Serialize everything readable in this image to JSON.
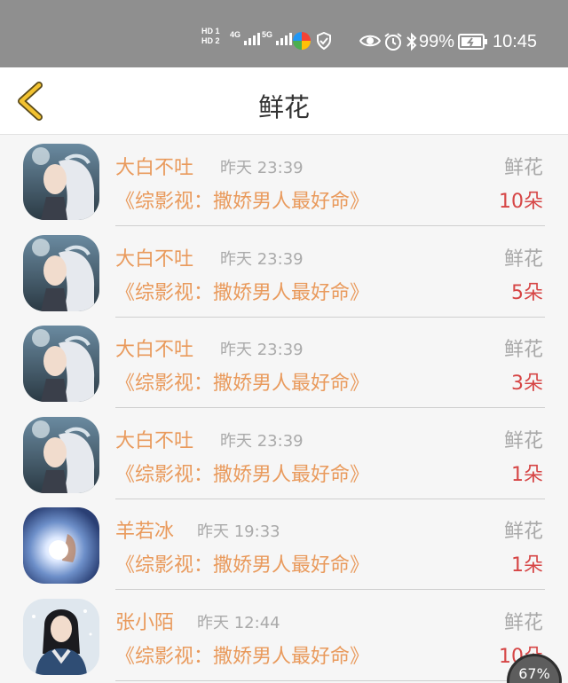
{
  "status_bar": {
    "hd1": "HD 1",
    "hd2": "HD 2",
    "net1": "4G",
    "net2": "5G",
    "battery": "99%",
    "time": "10:45",
    "icons": [
      "hd-icon",
      "signal-icon",
      "app-icon",
      "shield-icon",
      "eye-icon",
      "alarm-icon",
      "bluetooth-icon",
      "battery-icon"
    ]
  },
  "header": {
    "title": "鲜花",
    "back_icon": "chevron-left-icon",
    "accent": "#f2c230"
  },
  "rows": [
    {
      "name": "大白不吐",
      "time": "昨天 23:39",
      "kind": "鲜花",
      "book": "《综影视：撒娇男人最好命》",
      "count": "10朵",
      "avatar": "white-haired-girl"
    },
    {
      "name": "大白不吐",
      "time": "昨天 23:39",
      "kind": "鲜花",
      "book": "《综影视：撒娇男人最好命》",
      "count": "5朵",
      "avatar": "white-haired-girl"
    },
    {
      "name": "大白不吐",
      "time": "昨天 23:39",
      "kind": "鲜花",
      "book": "《综影视：撒娇男人最好命》",
      "count": "3朵",
      "avatar": "white-haired-girl"
    },
    {
      "name": "大白不吐",
      "time": "昨天 23:39",
      "kind": "鲜花",
      "book": "《综影视：撒娇男人最好命》",
      "count": "1朵",
      "avatar": "white-haired-girl"
    },
    {
      "name": "羊若冰",
      "time": "昨天 19:33",
      "kind": "鲜花",
      "book": "《综影视：撒娇男人最好命》",
      "count": "1朵",
      "avatar": "glowing-hand"
    },
    {
      "name": "张小陌",
      "time": "昨天 12:44",
      "kind": "鲜花",
      "book": "《综影视：撒娇男人最好命》",
      "count": "10朵",
      "avatar": "girl-in-snow"
    }
  ],
  "float_badge": "67%",
  "colors": {
    "name": "#e99a5c",
    "count": "#d64545",
    "status_bar": "#8f8f8f"
  }
}
